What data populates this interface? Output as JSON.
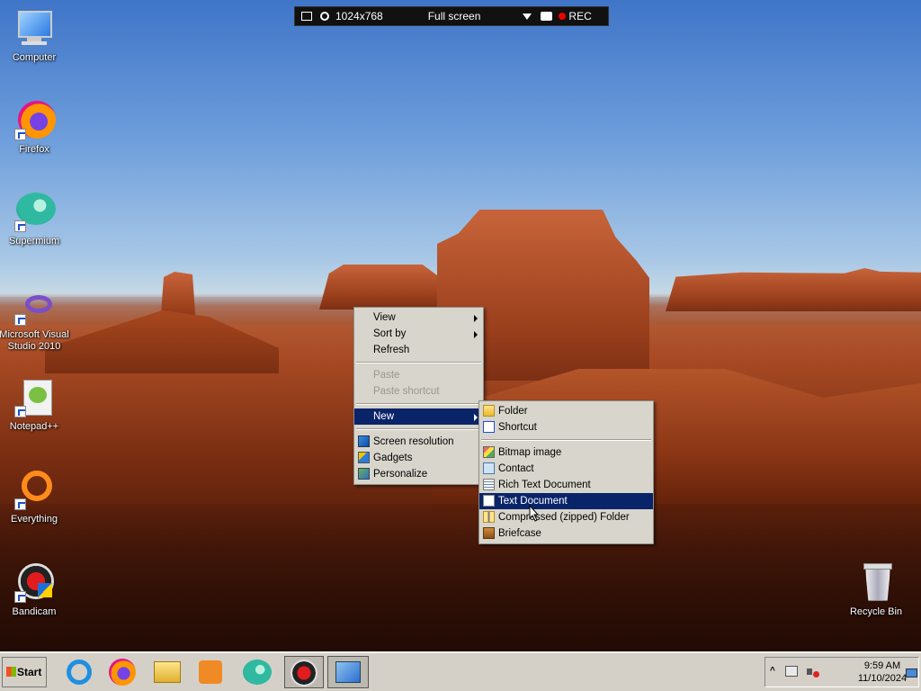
{
  "recorder_bar": {
    "resolution": "1024x768",
    "mode": "Full screen",
    "rec_label": "REC",
    "colors": {
      "rec": "#e00000"
    }
  },
  "desktop_icons": [
    {
      "label": "Computer",
      "icon": "computer-icon"
    },
    {
      "label": "Firefox",
      "icon": "firefox-icon"
    },
    {
      "label": "Supermium",
      "icon": "supermium-icon"
    },
    {
      "label": "Microsoft Visual Studio 2010",
      "icon": "visual-studio-icon"
    },
    {
      "label": "Notepad++",
      "icon": "notepadpp-icon"
    },
    {
      "label": "Everything",
      "icon": "everything-icon"
    },
    {
      "label": "Bandicam",
      "icon": "bandicam-icon"
    },
    {
      "label": "Recycle Bin",
      "icon": "recycle-bin-icon"
    }
  ],
  "context_menu": {
    "items": [
      {
        "label": "View",
        "submenu": true
      },
      {
        "label": "Sort by",
        "submenu": true
      },
      {
        "label": "Refresh"
      },
      {
        "label": "Paste",
        "disabled": true
      },
      {
        "label": "Paste shortcut",
        "disabled": true
      },
      {
        "label": "New",
        "submenu": true,
        "active": true
      },
      {
        "label": "Screen resolution",
        "icon": "screen-resolution-icon"
      },
      {
        "label": "Gadgets",
        "icon": "gadgets-icon"
      },
      {
        "label": "Personalize",
        "icon": "personalize-icon"
      }
    ]
  },
  "new_submenu": {
    "items": [
      {
        "label": "Folder",
        "icon": "folder-icon"
      },
      {
        "label": "Shortcut",
        "icon": "shortcut-icon"
      },
      {
        "label": "Bitmap image",
        "icon": "bitmap-icon"
      },
      {
        "label": "Contact",
        "icon": "contact-icon"
      },
      {
        "label": "Rich Text Document",
        "icon": "rtf-icon"
      },
      {
        "label": "Text Document",
        "icon": "text-document-icon",
        "highlighted": true
      },
      {
        "label": "Compressed (zipped) Folder",
        "icon": "zip-folder-icon"
      },
      {
        "label": "Briefcase",
        "icon": "briefcase-icon"
      }
    ]
  },
  "taskbar": {
    "start_label": "Start",
    "pinned": [
      "internet-explorer-icon",
      "firefox-icon",
      "file-explorer-icon",
      "media-player-icon",
      "supermium-icon",
      "bandicam-icon",
      "control-panel-icon"
    ],
    "clock_time": "9:59 AM",
    "clock_date": "11/10/2024"
  },
  "colors": {
    "menu_bg": "#d8d5cc",
    "menu_highlight": "#0a246a",
    "taskbar_bg": "#d4d0c8"
  }
}
